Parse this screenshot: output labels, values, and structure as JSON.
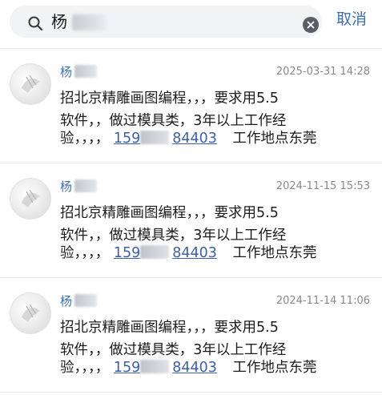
{
  "search": {
    "query": "杨",
    "cancel_label": "取消"
  },
  "results": [
    {
      "sender": "杨",
      "timestamp": "2025-03-31 14:28",
      "line1": "招北京精雕画图编程，，，要求用5.5",
      "line2": "软件，，做过模具类，3年以上工作经",
      "line3_prefix": "验，，，，",
      "phone_visible_start": "159",
      "phone_visible_end": "84403",
      "location": "工作地点东莞"
    },
    {
      "sender": "杨",
      "timestamp": "2024-11-15 15:53",
      "line1": "招北京精雕画图编程，，，要求用5.5",
      "line2": "软件，，做过模具类，3年以上工作经",
      "line3_prefix": "验，，，，",
      "phone_visible_start": "159",
      "phone_visible_end": "84403",
      "location": "工作地点东莞"
    },
    {
      "sender": "杨",
      "timestamp": "2024-11-14 11:06",
      "line1": "招北京精雕画图编程，，，要求用5.5",
      "line2": "软件，，做过模具类，3年以上工作经",
      "line3_prefix": "验，，，，",
      "phone_visible_start": "159",
      "phone_visible_end": "84403",
      "location": "工作地点东莞"
    }
  ],
  "colors": {
    "link": "#3b5fb0",
    "cancel": "#3b6fb6",
    "timestamp": "#8a8a8a"
  }
}
